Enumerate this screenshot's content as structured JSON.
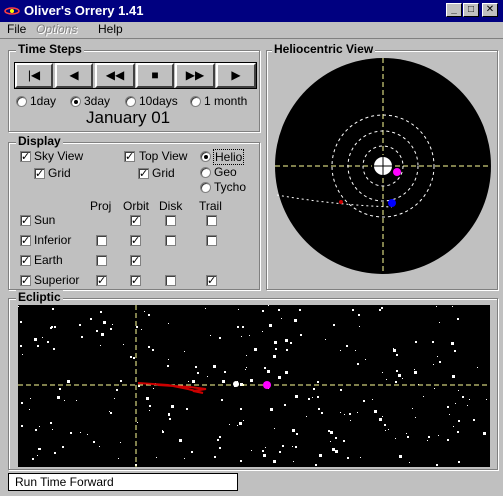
{
  "window": {
    "title": "Oliver's Orrery 1.41"
  },
  "menu": {
    "file": "File",
    "options": "Options",
    "help": "Help"
  },
  "time_steps": {
    "legend": "Time Steps",
    "buttons": [
      "|◀",
      "◀",
      "◀◀",
      "■",
      "▶▶",
      "▶"
    ],
    "options": [
      {
        "label": "1day",
        "selected": false
      },
      {
        "label": "3day",
        "selected": true
      },
      {
        "label": "10days",
        "selected": false
      },
      {
        "label": "1 month",
        "selected": false
      }
    ],
    "date": "January 01"
  },
  "display": {
    "legend": "Display",
    "sky_view": "Sky View",
    "sky_grid": "Grid",
    "top_view": "Top View",
    "top_grid": "Grid",
    "centers": [
      {
        "label": "Helio",
        "selected": true
      },
      {
        "label": "Geo",
        "selected": false
      },
      {
        "label": "Tycho",
        "selected": false
      }
    ],
    "columns": [
      "Proj",
      "Orbit",
      "Disk",
      "Trail"
    ],
    "rows": [
      {
        "label": "Sun",
        "checked": true,
        "proj": null,
        "orbit": true,
        "disk": false,
        "trail": false
      },
      {
        "label": "Inferior",
        "checked": true,
        "proj": false,
        "orbit": true,
        "disk": false,
        "trail": false
      },
      {
        "label": "Earth",
        "checked": true,
        "proj": false,
        "orbit": true,
        "disk": null,
        "trail": null
      },
      {
        "label": "Superior",
        "checked": true,
        "proj": true,
        "orbit": true,
        "disk": false,
        "trail": true
      }
    ]
  },
  "helio_view": {
    "legend": "Heliocentric View"
  },
  "ecliptic": {
    "legend": "Ecliptic"
  },
  "status": {
    "text": "Run Time Forward"
  },
  "colors": {
    "titlebar": "#000080",
    "earth": "#0000ff",
    "superior": "#ff00ff",
    "trail": "#cc0000"
  }
}
